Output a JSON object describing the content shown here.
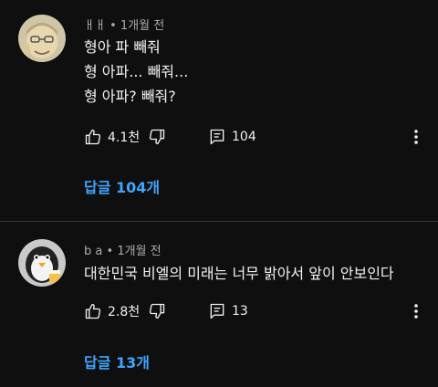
{
  "comments": [
    {
      "author": "ㅐㅐ",
      "time": "1개월 전",
      "lines": [
        "형아 파 빼줘",
        "형 아파... 빼줘...",
        "형 아파? 빼줘?"
      ],
      "likes": "4.1천",
      "reply_count": "104",
      "replies_label": "답글 104개"
    },
    {
      "author": "b a",
      "time": "1개월 전",
      "lines": [
        "대한민국 비엘의 미래는 너무 밝아서 앞이 안보인다"
      ],
      "likes": "2.8천",
      "reply_count": "13",
      "replies_label": "답글 13개"
    }
  ],
  "separator": "•",
  "icons": {
    "like": "thumbs-up-icon",
    "dislike": "thumbs-down-icon",
    "reply": "comment-icon",
    "more": "more-vertical-icon"
  },
  "colors": {
    "background": "#0f0f0f",
    "text": "#f1f1f1",
    "muted": "#aaaaaa",
    "link": "#3ea6ff"
  }
}
